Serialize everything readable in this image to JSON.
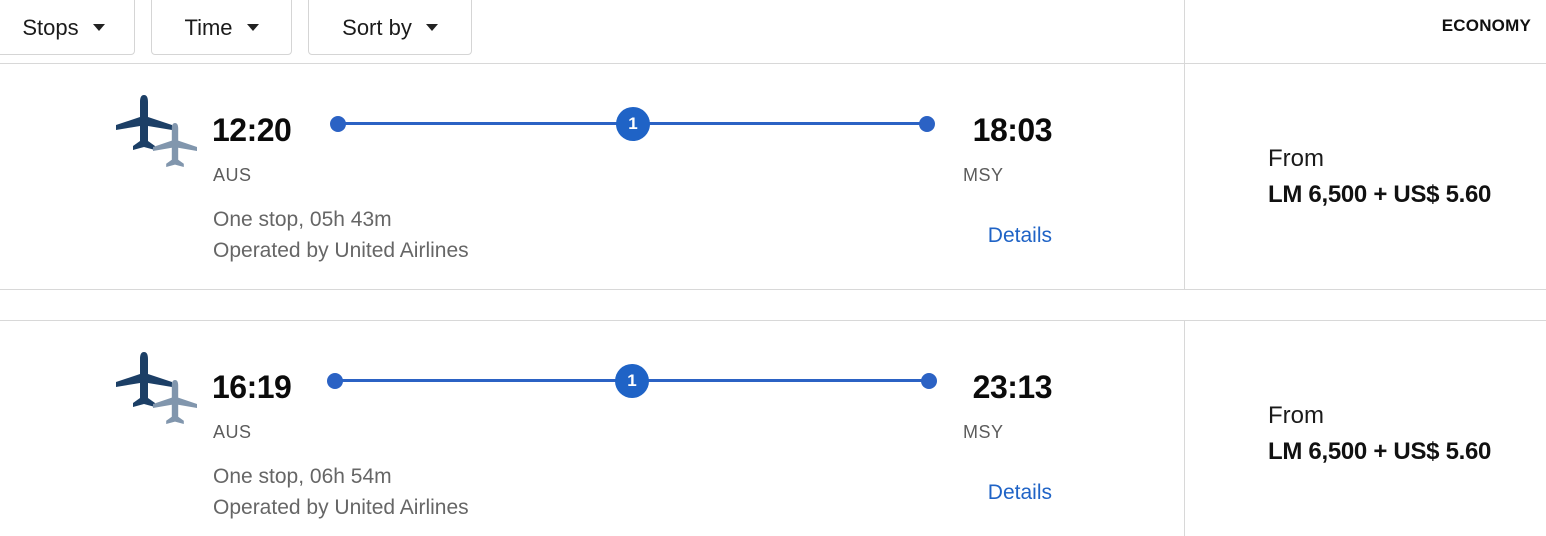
{
  "filters": {
    "stops_label": "Stops",
    "time_label": "Time",
    "sort_label": "Sort by"
  },
  "cabin": {
    "label": "ECONOMY"
  },
  "accent_color": "#1f63c6",
  "flights": [
    {
      "departure_time": "12:20",
      "arrival_time": "18:03",
      "origin": "AUS",
      "destination": "MSY",
      "stops": "1",
      "duration": "One stop, 05h 43m",
      "operator": "Operated by United Airlines",
      "details_label": "Details",
      "price_prefix": "From",
      "price": "LM 6,500 + US$ 5.60"
    },
    {
      "departure_time": "16:19",
      "arrival_time": "23:13",
      "origin": "AUS",
      "destination": "MSY",
      "stops": "1",
      "duration": "One stop, 06h 54m",
      "operator": "Operated by United Airlines",
      "details_label": "Details",
      "price_prefix": "From",
      "price": "LM 6,500 + US$ 5.60"
    }
  ]
}
